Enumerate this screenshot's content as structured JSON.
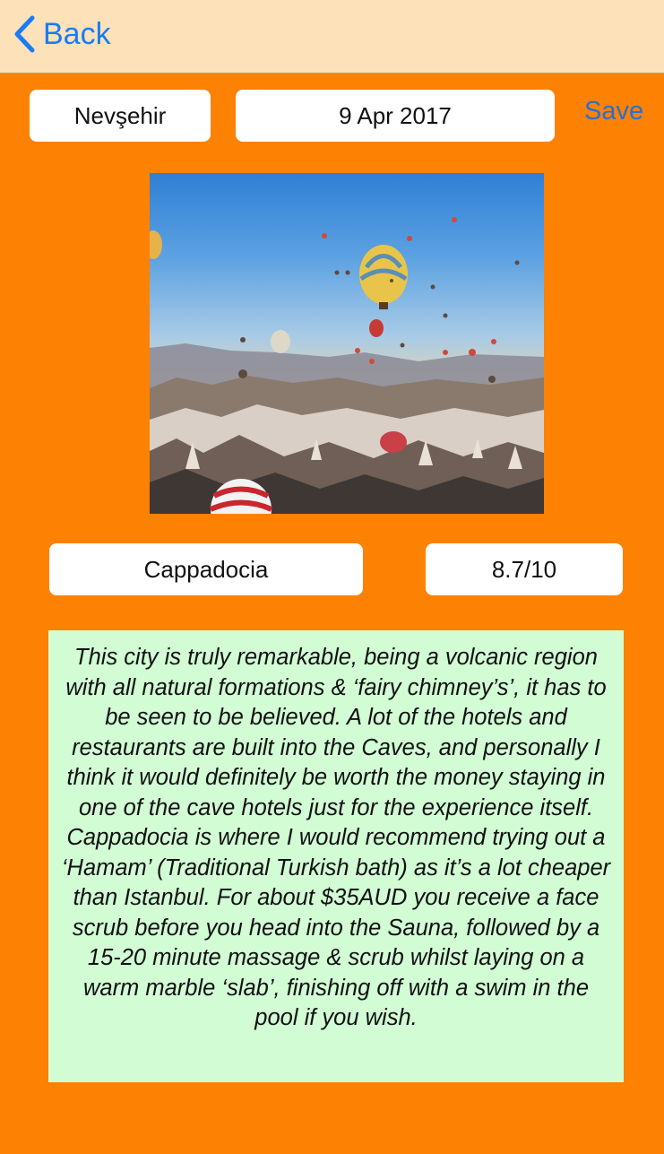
{
  "nav": {
    "back_label": "Back"
  },
  "form": {
    "city": "Nevşehir",
    "date": "9 Apr 2017",
    "save_label": "Save",
    "place": "Cappadocia",
    "rating": "8.7/10"
  },
  "photo": {
    "subject": "hot-air balloons over Cappadocia valley"
  },
  "description": "This city is truly remarkable, being a volcanic region with all natural formations & ‘fairy chimney’s’, it has to be seen to be believed. A lot of the hotels and restaurants are built into the Caves, and personally I think it would definitely be worth the money staying in one of the cave hotels just for the experience itself. Cappadocia is where I would recommend trying out a ‘Hamam’ (Traditional Turkish bath) as it’s a lot cheaper than Istanbul.  For about $35AUD you receive a face scrub before you head into the Sauna, followed by a 15-20 minute massage & scrub whilst laying on a warm marble ‘slab’, finishing off with a swim in the pool if you wish.",
  "colors": {
    "background": "#fd8102",
    "navbar": "#fde2b9",
    "accent": "#1a7cf5",
    "description_bg": "#d1fcd4"
  }
}
